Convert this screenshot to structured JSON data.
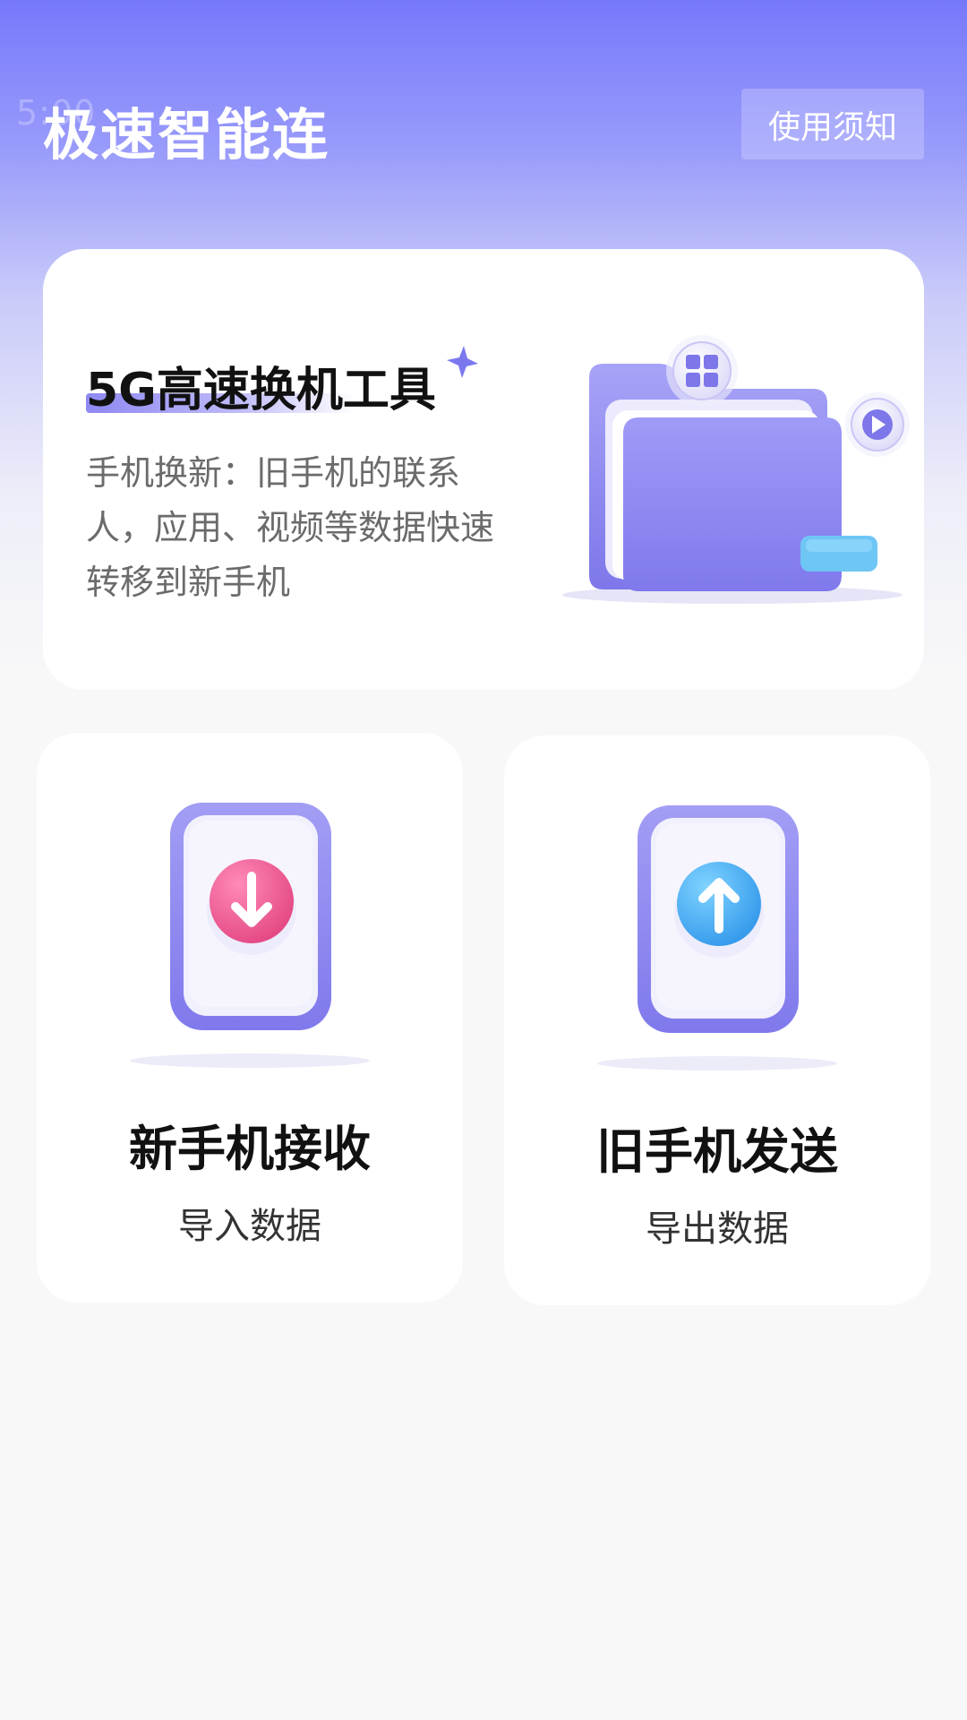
{
  "header": {
    "status_ghost": "5:00",
    "title": "极速智能连",
    "notice_label": "使用须知"
  },
  "hero": {
    "title": "5G高速换机工具",
    "description": "手机换新：旧手机的联系人，应用、视频等数据快速转移到新手机"
  },
  "actions": [
    {
      "title": "新手机接收",
      "subtitle": "导入数据",
      "icon": "arrow-down-icon",
      "color": "#ee5b96"
    },
    {
      "title": "旧手机发送",
      "subtitle": "导出数据",
      "icon": "arrow-up-icon",
      "color": "#3aa6f0"
    }
  ],
  "colors": {
    "brand": "#7678fb",
    "card": "#ffffff",
    "accent_purple": "#8e88f2"
  }
}
